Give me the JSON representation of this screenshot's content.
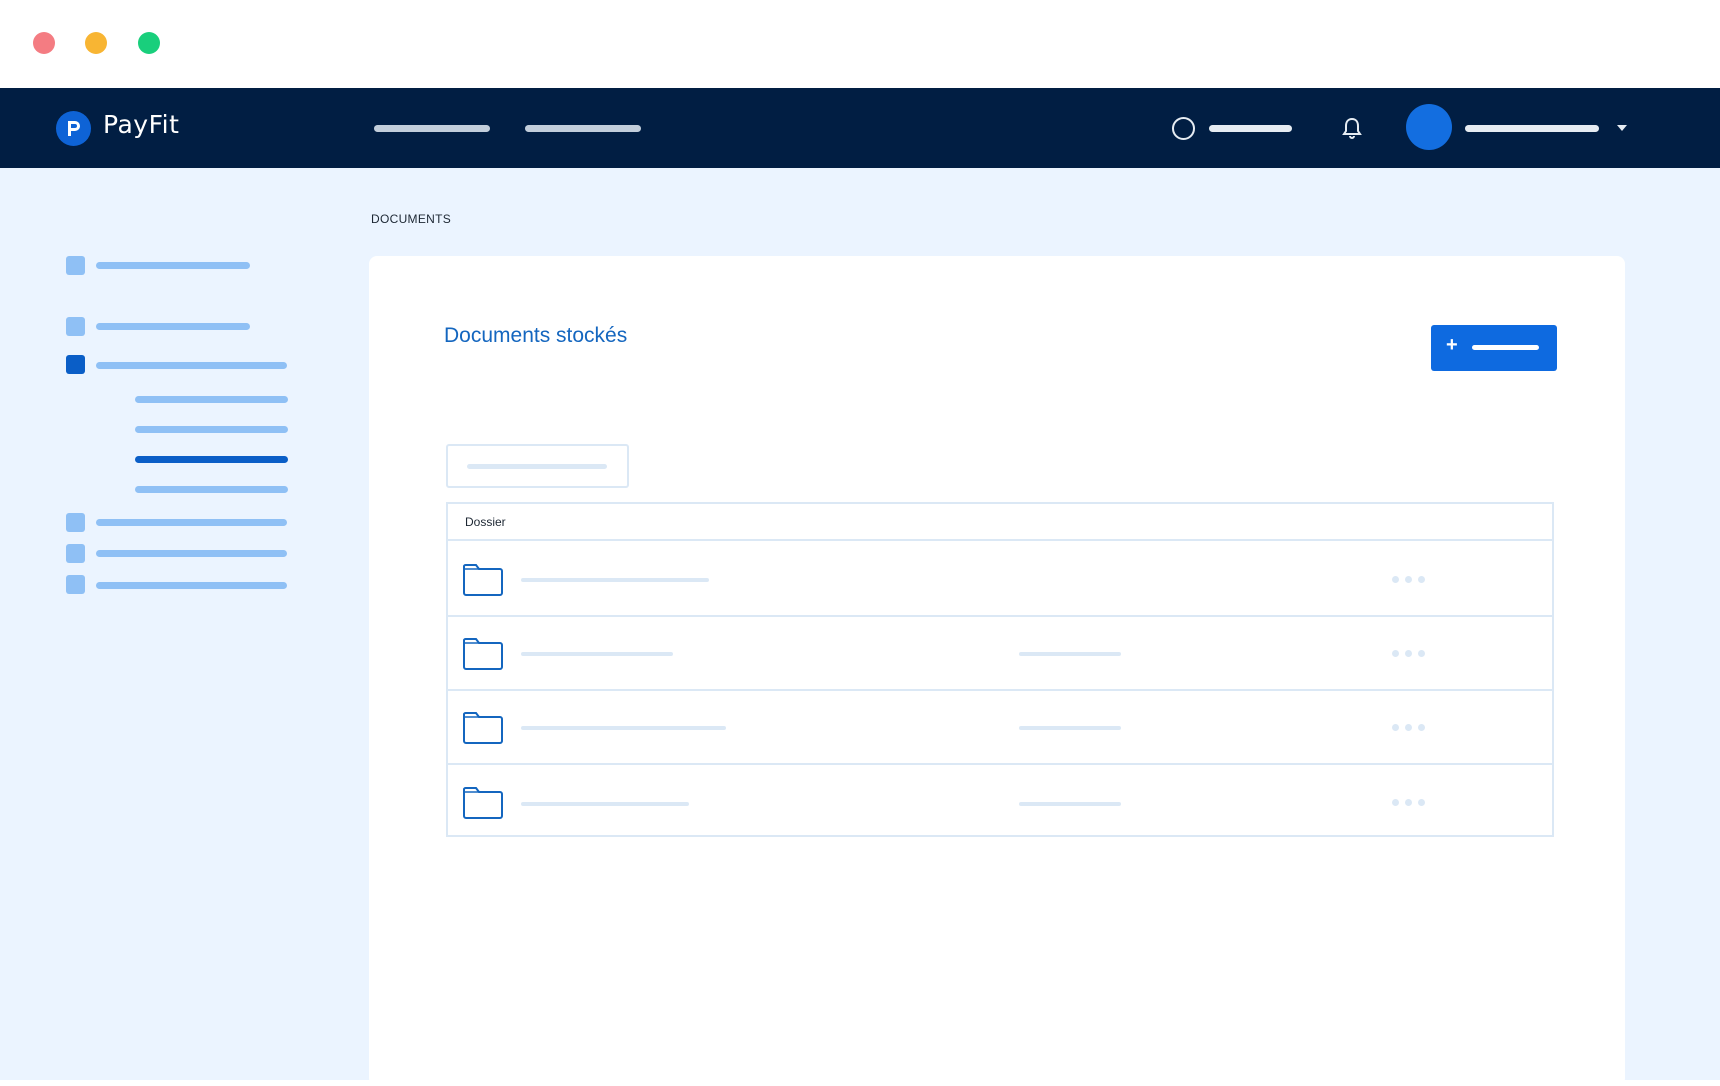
{
  "window": {
    "controls": [
      "close",
      "minimize",
      "maximize"
    ],
    "colors": {
      "close": "#f47c82",
      "minimize": "#f8b533",
      "maximize": "#19cf7c"
    }
  },
  "header": {
    "brand": "PayFit",
    "logo_icon": "payfit-logo-icon",
    "background": "#011e43",
    "nav_items": [
      "",
      ""
    ],
    "search_icon": "search-circle-icon",
    "notification_icon": "bell-icon",
    "user_menu_icon": "caret-down-icon",
    "accent": "#136ee0"
  },
  "sidebar": {
    "items": [
      {
        "label": "",
        "active": false
      },
      {
        "label": "",
        "active": false
      },
      {
        "label": "",
        "active": true,
        "children": [
          {
            "label": "",
            "active": false
          },
          {
            "label": "",
            "active": false
          },
          {
            "label": "",
            "active": true
          },
          {
            "label": "",
            "active": false
          }
        ]
      },
      {
        "label": "",
        "active": false
      },
      {
        "label": "",
        "active": false
      },
      {
        "label": "",
        "active": false
      }
    ]
  },
  "main": {
    "breadcrumb": "DOCUMENTS",
    "title": "Documents stockés",
    "add_button": {
      "icon": "+",
      "label": ""
    },
    "filter": {
      "placeholder": ""
    },
    "table": {
      "columns": [
        "Dossier"
      ],
      "rows": [
        {
          "icon": "folder-icon",
          "name": "",
          "date": "",
          "actions_icon": "more-dots-icon"
        },
        {
          "icon": "folder-icon",
          "name": "",
          "date": "",
          "actions_icon": "more-dots-icon"
        },
        {
          "icon": "folder-icon",
          "name": "",
          "date": "",
          "actions_icon": "more-dots-icon"
        },
        {
          "icon": "folder-icon",
          "name": "",
          "date": "",
          "actions_icon": "more-dots-icon"
        }
      ]
    }
  }
}
